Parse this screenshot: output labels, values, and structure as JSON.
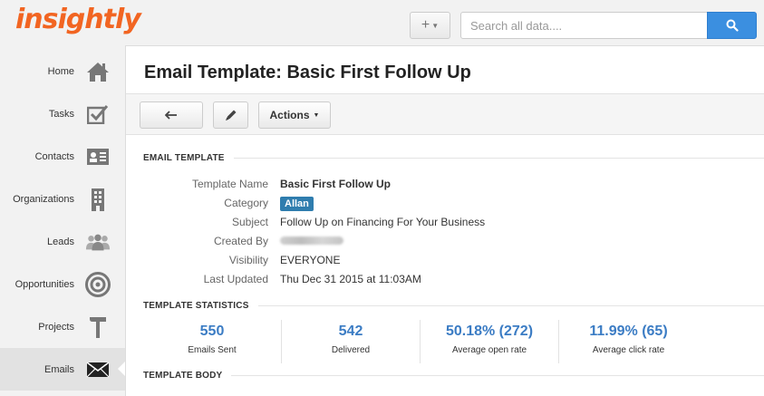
{
  "header": {
    "logo": "insightly",
    "add_label": "+",
    "search_placeholder": "Search all data....",
    "search_icon": "search-icon"
  },
  "sidebar": {
    "items": [
      {
        "label": "Home",
        "icon": "home-icon"
      },
      {
        "label": "Tasks",
        "icon": "checkbox-icon"
      },
      {
        "label": "Contacts",
        "icon": "contact-card-icon"
      },
      {
        "label": "Organizations",
        "icon": "building-icon"
      },
      {
        "label": "Leads",
        "icon": "people-icon"
      },
      {
        "label": "Opportunities",
        "icon": "target-icon"
      },
      {
        "label": "Projects",
        "icon": "hammer-icon"
      },
      {
        "label": "Emails",
        "icon": "envelope-icon",
        "active": true
      }
    ]
  },
  "page": {
    "title": "Email Template: Basic First Follow Up"
  },
  "toolbar": {
    "back_icon": "back-arrow-icon",
    "edit_icon": "pencil-icon",
    "actions_label": "Actions"
  },
  "email_template": {
    "heading": "EMAIL TEMPLATE",
    "rows": [
      {
        "label": "Template Name",
        "value": "Basic First Follow Up"
      },
      {
        "label": "Category",
        "value": "Allan"
      },
      {
        "label": "Subject",
        "value": "Follow Up on Financing For Your Business"
      },
      {
        "label": "Created By",
        "value": ""
      },
      {
        "label": "Visibility",
        "value": "EVERYONE"
      },
      {
        "label": "Last Updated",
        "value": "Thu Dec 31 2015 at 11:03AM"
      }
    ]
  },
  "statistics": {
    "heading": "TEMPLATE STATISTICS",
    "items": [
      {
        "value": "550",
        "caption": "Emails Sent"
      },
      {
        "value": "542",
        "caption": "Delivered"
      },
      {
        "value": "50.18% (272)",
        "caption": "Average open rate"
      },
      {
        "value": "11.99% (65)",
        "caption": "Average click rate"
      }
    ]
  },
  "body_section": {
    "heading": "TEMPLATE BODY"
  },
  "colors": {
    "brand": "#f26522",
    "accent": "#3b8fe0",
    "stat": "#3b7cc4",
    "tag": "#2f7dae"
  }
}
